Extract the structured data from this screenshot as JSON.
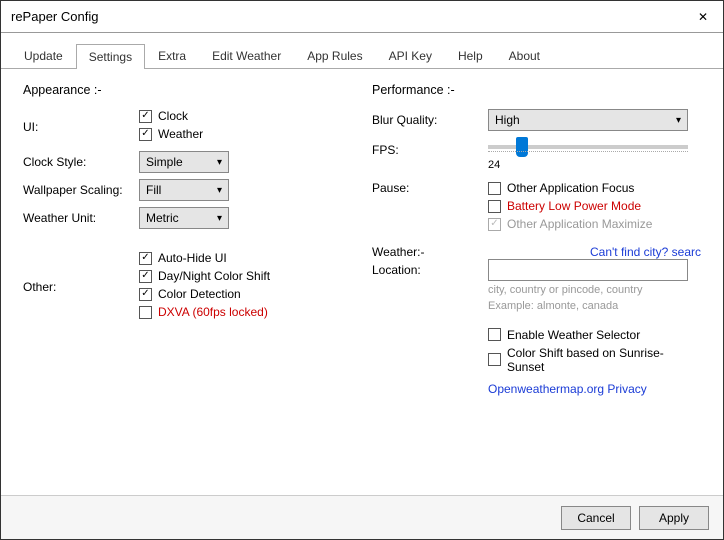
{
  "window": {
    "title": "rePaper Config"
  },
  "tabs": [
    "Update",
    "Settings",
    "Extra",
    "Edit Weather",
    "App Rules",
    "API Key",
    "Help",
    "About"
  ],
  "active_tab": "Settings",
  "left": {
    "header": "Appearance :-",
    "ui_label": "UI:",
    "ui_items": {
      "clock": "Clock",
      "weather": "Weather"
    },
    "clock_style_label": "Clock Style:",
    "clock_style_value": "Simple",
    "wallpaper_scaling_label": "Wallpaper Scaling:",
    "wallpaper_scaling_value": "Fill",
    "weather_unit_label": "Weather Unit:",
    "weather_unit_value": "Metric",
    "other_label": "Other:",
    "other_items": {
      "auto_hide": "Auto-Hide UI",
      "daynight": "Day/Night Color Shift",
      "color_detect": "Color Detection",
      "dxva": "DXVA (60fps locked)"
    }
  },
  "right": {
    "header": "Performance :-",
    "blur_label": "Blur Quality:",
    "blur_value": "High",
    "fps_label": "FPS:",
    "fps_value": "24",
    "pause_label": "Pause:",
    "pause_items": {
      "app_focus": "Other Application Focus",
      "battery": "Battery Low Power Mode",
      "app_max": "Other Application Maximize"
    },
    "weather_header": "Weather:-",
    "location_label": "Location:",
    "find_city": "Can't find city? searc",
    "location_hint1": "city, country or pincode, country",
    "location_hint2": "Example: almonte, canada",
    "enable_selector": "Enable Weather Selector",
    "sunrise_shift": "Color Shift based on Sunrise-Sunset",
    "privacy_link": "Openweathermap.org Privacy"
  },
  "footer": {
    "cancel": "Cancel",
    "apply": "Apply"
  }
}
